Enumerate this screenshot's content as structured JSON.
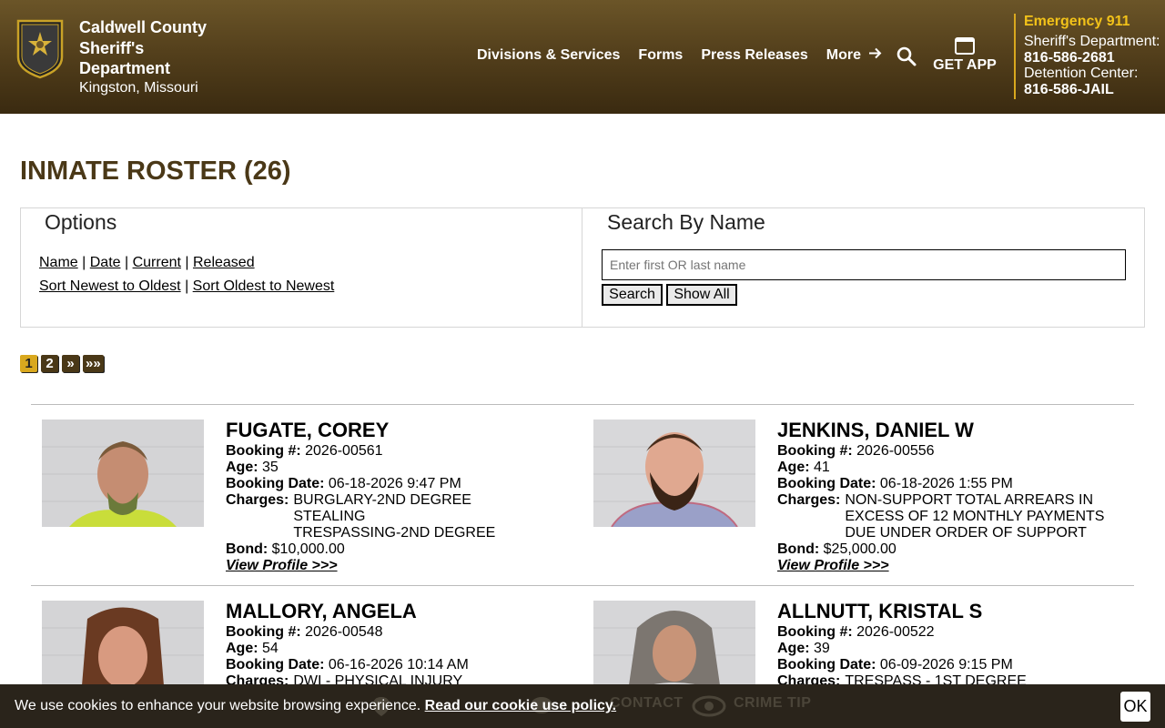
{
  "header": {
    "org_name": "Caldwell County Sheriff's Department",
    "location": "Kingston, Missouri",
    "nav": [
      "Divisions & Services",
      "Forms",
      "Press Releases",
      "More"
    ],
    "get_app": "GET APP",
    "emergency": "Emergency 911",
    "dept_label": "Sheriff's Department:",
    "dept_phone": "816-586-2681",
    "detention_label": "Detention Center:",
    "detention_phone": "816-586-JAIL"
  },
  "page": {
    "title": "INMATE ROSTER (26)"
  },
  "options": {
    "legend": "Options",
    "filters": [
      "Name",
      "Date",
      "Current",
      "Released"
    ],
    "sorts": [
      "Sort Newest to Oldest",
      "Sort Oldest to Newest"
    ]
  },
  "search": {
    "legend": "Search By Name",
    "placeholder": "Enter first OR last name",
    "search_label": "Search",
    "show_all_label": "Show All"
  },
  "pagination": [
    "1",
    "2",
    "»",
    "»»"
  ],
  "labels": {
    "booking": "Booking #:",
    "age": "Age:",
    "booking_date": "Booking Date:",
    "charges": "Charges:",
    "bond": "Bond:",
    "view_profile": "View Profile >>>"
  },
  "inmates": [
    {
      "name": "FUGATE, COREY",
      "booking": "2026-00561",
      "age": "35",
      "booking_date": "06-18-2026 9:47 PM",
      "charges": [
        "BURGLARY-2ND DEGREE",
        "STEALING",
        "TRESPASSING-2ND DEGREE"
      ],
      "bond": "$10,000.00"
    },
    {
      "name": "JENKINS, DANIEL W",
      "booking": "2026-00556",
      "age": "41",
      "booking_date": "06-18-2026 1:55 PM",
      "charges": [
        "NON-SUPPORT TOTAL ARREARS IN EXCESS OF 12 MONTHLY PAYMENTS DUE UNDER ORDER OF SUPPORT"
      ],
      "bond": "$25,000.00"
    },
    {
      "name": "MALLORY, ANGELA",
      "booking": "2026-00548",
      "age": "54",
      "booking_date": "06-16-2026 10:14 AM",
      "charges": [
        "DWI - PHYSICAL INJURY"
      ]
    },
    {
      "name": "ALLNUTT, KRISTAL S",
      "booking": "2026-00522",
      "age": "39",
      "booking_date": "06-09-2026 9:15 PM",
      "charges": [
        "TRESPASS - 1ST DEGREE"
      ]
    }
  ],
  "cookie": {
    "text": "We use cookies to enhance your website browsing experience.",
    "link": "Read our cookie use policy.",
    "ok": "OK",
    "behind": [
      "CONTACT",
      "CRIME TIP"
    ]
  },
  "colors": {
    "header_brown": "#54401c",
    "title_brown": "#4a3817",
    "accent_gold": "#d9a81e",
    "emergency_yellow": "#f2c219"
  }
}
